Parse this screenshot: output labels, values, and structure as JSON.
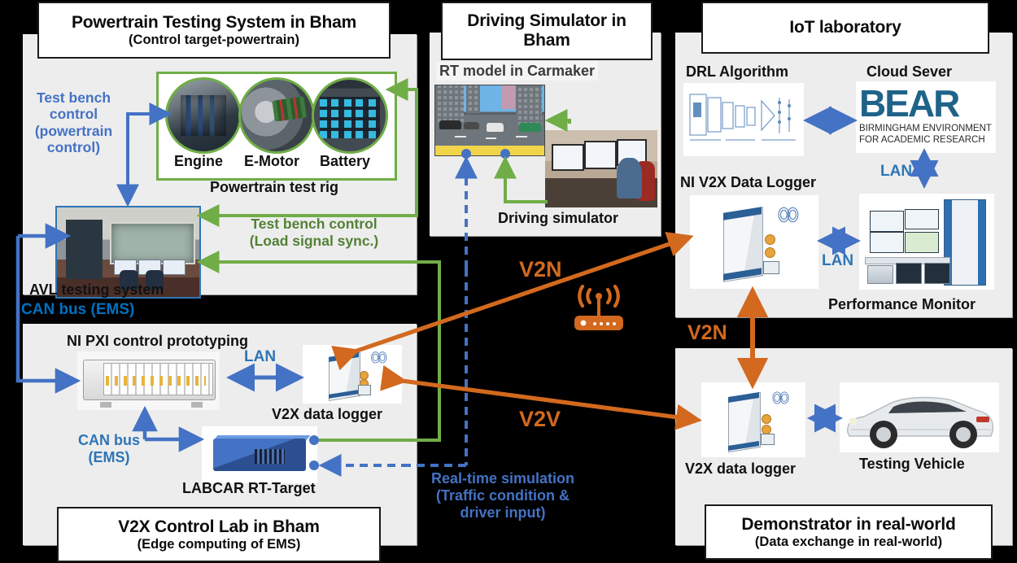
{
  "colors": {
    "panel_bg": "#ededed",
    "blue_text": "#4472c4",
    "blue_bright": "#0070c0",
    "blue_arrow": "#4472c4",
    "green": "#70ad47",
    "green_text": "#538135",
    "orange": "#d2691e",
    "border_dark": "#1a1a1a"
  },
  "panels": {
    "powertrain": {
      "title_line1": "Powertrain Testing System in Bham",
      "title_line2": "(Control target-powertrain)",
      "test_rig_caption": "Powertrain test rig",
      "components": [
        {
          "label": "Engine"
        },
        {
          "label": "E-Motor"
        },
        {
          "label": "Battery"
        }
      ],
      "avl_caption": "AVL testing system",
      "arrow_label_blue": "Test bench\ncontrol\n(powertrain\ncontrol)",
      "arrow_label_blue_lines": [
        "Test bench",
        "control",
        "(powertrain",
        "control)"
      ],
      "arrow_label_green_lines": [
        "Test bench control",
        "(Load signal sync.)"
      ]
    },
    "v2x_lab": {
      "title_line1": "V2X Control Lab in Bham",
      "title_line2": "(Edge computing of EMS)",
      "pxi_caption": "NI PXI control prototyping",
      "logger_caption": "V2X data logger",
      "labcar_caption": "LABCAR RT-Target",
      "lan_label": "LAN",
      "can_label_lines": [
        "CAN bus",
        "(EMS)"
      ],
      "can_top_label": "CAN bus (EMS)"
    },
    "driving_sim": {
      "title_line1": "Driving Simulator in",
      "title_line2": "Bham",
      "rt_model_label": "RT model in Carmaker",
      "sim_caption": "Driving simulator"
    },
    "iot_lab": {
      "title_line1": "IoT laboratory",
      "drl_caption": "DRL Algorithm",
      "cloud_caption": "Cloud Sever",
      "bear_logo": "BEAR",
      "bear_sub_line1": "BIRMINGHAM ENVIRONMENT",
      "bear_sub_line2": "FOR ACADEMIC RESEARCH",
      "logger_caption": "NI V2X Data Logger",
      "monitor_caption": "Performance Monitor",
      "lan_label_top": "LAN",
      "lan_label_mid": "LAN"
    },
    "demonstrator": {
      "title_line1": "Demonstrator in real-world",
      "title_line2": "(Data exchange in real-world)",
      "logger_caption": "V2X data logger",
      "vehicle_caption": "Testing Vehicle"
    }
  },
  "links": {
    "v2n_top": "V2N",
    "v2n_right": "V2N",
    "v2v": "V2V",
    "realtime_lines": [
      "Real-time simulation",
      "(Traffic condition &",
      "driver input)"
    ],
    "router_icon": "wireless-router-icon"
  }
}
